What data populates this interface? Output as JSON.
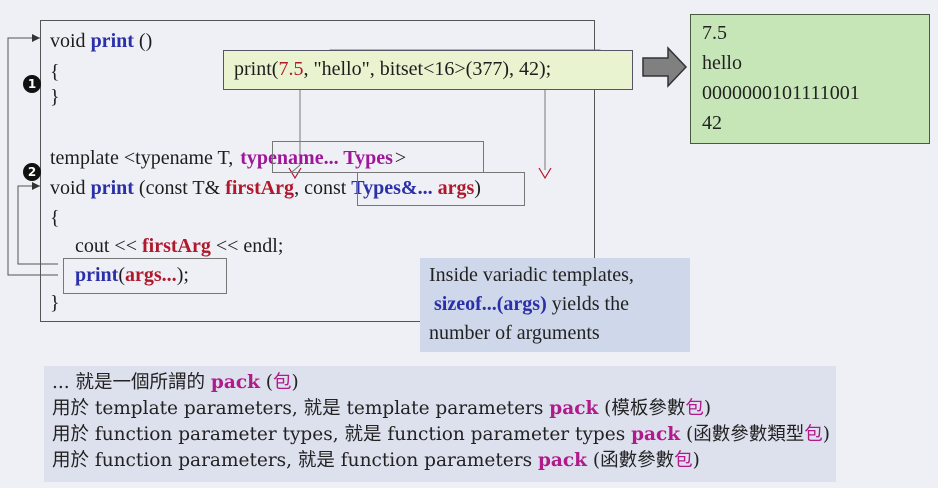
{
  "code": {
    "line1": {
      "kw": "void ",
      "name": "print",
      "rest": " ()"
    },
    "open1": "{",
    "close1": "}",
    "template_line": {
      "a": "template <typename T, ",
      "b": "typename... Types",
      "c": ">"
    },
    "line2": {
      "kw": "void ",
      "name": "print",
      "a": " (const T& ",
      "first": "firstArg",
      ",": ", ",
      "b": "const ",
      "types": "Types&...",
      "c": " ",
      "args": "args",
      ")": ")"
    },
    "open2": "{",
    "cout_line": {
      "a": "cout << ",
      "first": "firstArg",
      "b": " << endl;"
    },
    "print_line": {
      "name": "print",
      "a": "(",
      "args": "args...",
      "b": ");"
    },
    "close2": "}"
  },
  "bullets": [
    "1",
    "2"
  ],
  "call": {
    "a": "print(",
    "n1": "7.5",
    ",": ", ",
    "s": "\"hello\"",
    "b": ", bitset<16>(377), 42);"
  },
  "output": [
    "7.5",
    "hello",
    "0000000101111001",
    "42"
  ],
  "note": {
    "l1": "Inside variadic templates,",
    "l2_a": "sizeof...(args)",
    "l2_b": " yields the",
    "l3": "number of arguments"
  },
  "bottom": {
    "l1_a": "... 就是一個所謂的 ",
    "l1_pack": "pack",
    "l1_b": " (",
    "l1_bao": "包",
    "l1_c": ")",
    "l2_a": "用於 template parameters, 就是 template parameters ",
    "l2_pack": "pack",
    "l2_b": " (模板參數",
    "l2_bao": "包",
    "l2_c": ")",
    "l3_a": "用於 function parameter types, 就是 function parameter types ",
    "l3_pack": "pack",
    "l3_b": " (函數參數類型",
    "l3_bao": "包",
    "l3_c": ")",
    "l4_a": "用於 function parameters, 就是 function parameters ",
    "l4_pack": "pack",
    "l4_b": " (函數參數",
    "l4_bao": "包",
    "l4_c": ")"
  },
  "colors": {
    "blue": "#2b2fa8",
    "red": "#b0182c",
    "magenta": "#a0169a",
    "output_bg": "#c7e6b8",
    "call_bg": "#e9f3d0",
    "note_bg": "#cfd7ea"
  }
}
